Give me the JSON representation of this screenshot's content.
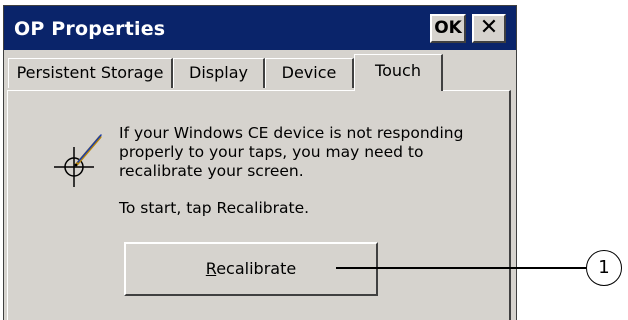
{
  "dialog": {
    "title": "OP Properties",
    "ok_label": "OK",
    "close_label": "✕"
  },
  "tabs": [
    {
      "label": "Persistent Storage",
      "active": false
    },
    {
      "label": "Display",
      "active": false
    },
    {
      "label": "Device",
      "active": false
    },
    {
      "label": "Touch",
      "active": true
    }
  ],
  "touch_panel": {
    "message_lines": [
      "If your Windows CE device is not responding",
      "properly to your taps, you may need to",
      "recalibrate your screen."
    ],
    "start_text": "To start, tap Recalibrate.",
    "recalibrate_label": "Recalibrate",
    "recalibrate_mnemonic": "R"
  },
  "callout": {
    "number": "1"
  },
  "colors": {
    "titlebar": "#0a246a",
    "face": "#d6d3ce",
    "shadow": "#404040",
    "highlight": "#ffffff"
  },
  "icons": {
    "stylus": "stylus-crosshair-icon",
    "close": "close-icon"
  }
}
